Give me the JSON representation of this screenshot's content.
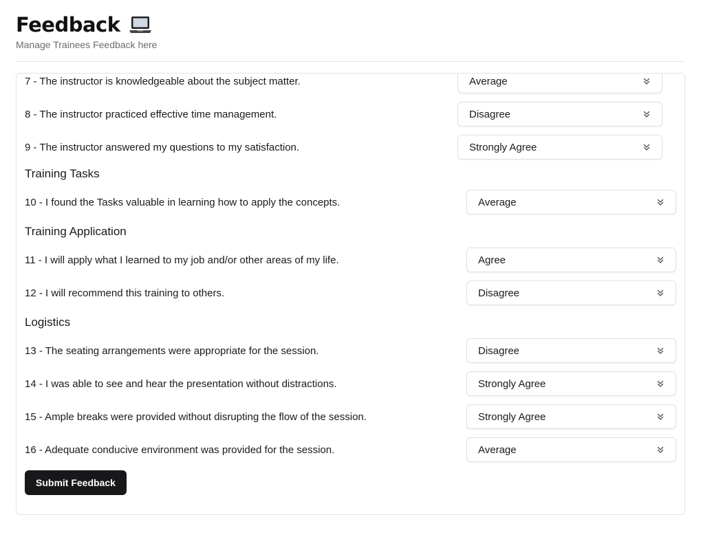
{
  "header": {
    "title": "Feedback",
    "subtitle": "Manage Trainees Feedback here",
    "title_icon": "laptop-icon"
  },
  "questions_partial": [
    {
      "text": "7 - The instructor is knowledgeable about the subject matter.",
      "answer": "Average"
    },
    {
      "text": "8 - The instructor practiced effective time management.",
      "answer": "Disagree"
    },
    {
      "text": "9 - The instructor answered my questions to my satisfaction.",
      "answer": "Strongly Agree"
    }
  ],
  "sections": [
    {
      "title": "Training Tasks",
      "questions": [
        {
          "text": "10 - I found the Tasks valuable in learning how to apply the concepts.",
          "answer": "Average"
        }
      ]
    },
    {
      "title": "Training Application",
      "questions": [
        {
          "text": "11 - I will apply what I learned to my job and/or other areas of my life.",
          "answer": "Agree"
        },
        {
          "text": "12 - I will recommend this training to others.",
          "answer": "Disagree"
        }
      ]
    },
    {
      "title": "Logistics",
      "questions": [
        {
          "text": "13 - The seating arrangements were appropriate for the session.",
          "answer": "Disagree"
        },
        {
          "text": "14 - I was able to see and hear the presentation without distractions.",
          "answer": "Strongly Agree"
        },
        {
          "text": "15 - Ample breaks were provided without disrupting the flow of the session.",
          "answer": "Strongly Agree"
        },
        {
          "text": "16 - Adequate conducive environment was provided for the session.",
          "answer": "Average"
        }
      ]
    }
  ],
  "submit_label": "Submit Feedback",
  "colors": {
    "button_bg": "#18181b",
    "border": "#e4e4e7",
    "subtitle": "#6b6b6b"
  }
}
